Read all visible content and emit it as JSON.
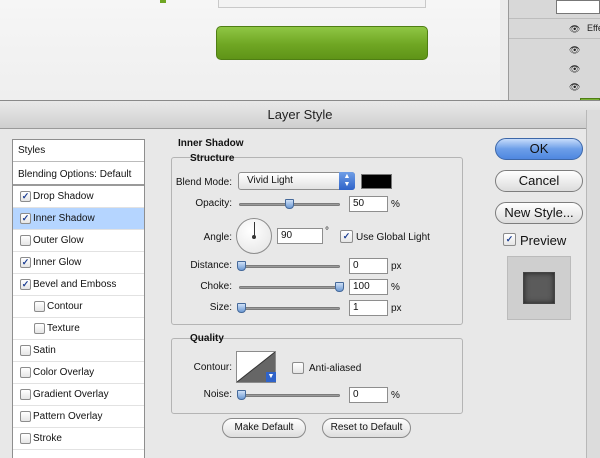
{
  "dialog": {
    "title": "Layer Style"
  },
  "styles_list": {
    "header": "Styles",
    "blending": "Blending Options: Default",
    "items": [
      {
        "label": "Drop Shadow",
        "checked": true,
        "indent": false,
        "selected": false
      },
      {
        "label": "Inner Shadow",
        "checked": true,
        "indent": false,
        "selected": true
      },
      {
        "label": "Outer Glow",
        "checked": false,
        "indent": false,
        "selected": false
      },
      {
        "label": "Inner Glow",
        "checked": true,
        "indent": false,
        "selected": false
      },
      {
        "label": "Bevel and Emboss",
        "checked": true,
        "indent": false,
        "selected": false
      },
      {
        "label": "Contour",
        "checked": false,
        "indent": true,
        "selected": false
      },
      {
        "label": "Texture",
        "checked": false,
        "indent": true,
        "selected": false
      },
      {
        "label": "Satin",
        "checked": false,
        "indent": false,
        "selected": false
      },
      {
        "label": "Color Overlay",
        "checked": false,
        "indent": false,
        "selected": false
      },
      {
        "label": "Gradient Overlay",
        "checked": false,
        "indent": false,
        "selected": false
      },
      {
        "label": "Pattern Overlay",
        "checked": false,
        "indent": false,
        "selected": false
      },
      {
        "label": "Stroke",
        "checked": false,
        "indent": false,
        "selected": false
      }
    ]
  },
  "pane": {
    "title": "Inner Shadow",
    "structure": {
      "title": "Structure",
      "blend_mode_label": "Blend Mode:",
      "blend_mode_value": "Vivid Light",
      "swatch_color": "#000000",
      "opacity_label": "Opacity:",
      "opacity_value": "50",
      "opacity_unit": "%",
      "opacity_level": 0.5,
      "angle_label": "Angle:",
      "angle_value": "90",
      "angle_unit": "°",
      "global_light_label": "Use Global Light",
      "global_light_checked": true,
      "distance_label": "Distance:",
      "distance_value": "0",
      "distance_unit": "px",
      "choke_label": "Choke:",
      "choke_value": "100",
      "choke_unit": "%",
      "size_label": "Size:",
      "size_value": "1",
      "size_unit": "px"
    },
    "quality": {
      "title": "Quality",
      "contour_label": "Contour:",
      "anti_aliased_label": "Anti-aliased",
      "anti_aliased_checked": false,
      "noise_label": "Noise:",
      "noise_value": "0",
      "noise_unit": "%"
    },
    "make_default": "Make Default",
    "reset_default": "Reset to Default"
  },
  "buttons": {
    "ok": "OK",
    "cancel": "Cancel",
    "new_style": "New Style...",
    "preview_label": "Preview",
    "preview_checked": true
  },
  "background": {
    "effects_label": "Effe",
    "accent_green": "#6fa623"
  }
}
